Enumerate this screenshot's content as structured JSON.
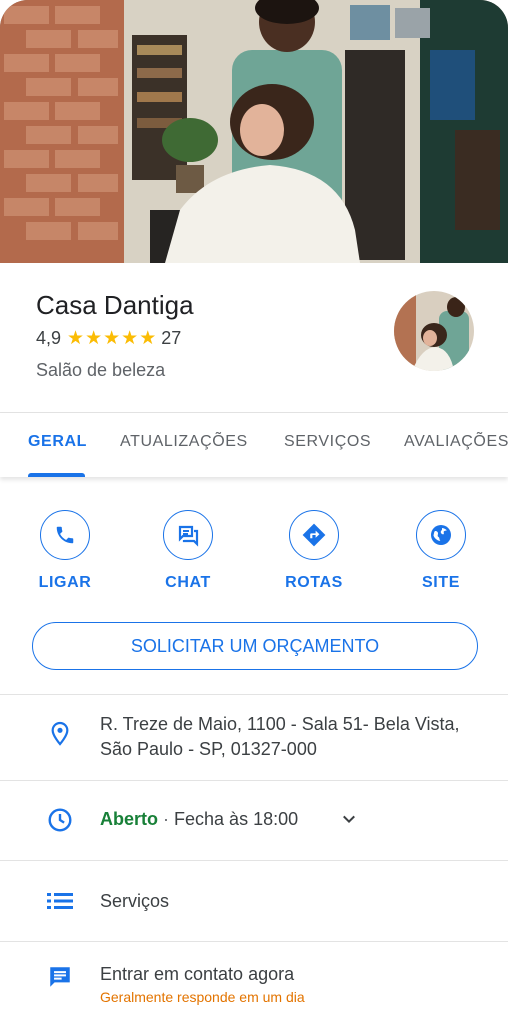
{
  "place": {
    "name": "Casa Dantiga",
    "rating": "4,9",
    "review_count": "27",
    "stars": 4.9,
    "category": "Salão de beleza"
  },
  "tabs": [
    {
      "label": "GERAL",
      "active": true
    },
    {
      "label": "ATUALIZAÇÕES",
      "active": false
    },
    {
      "label": "SERVIÇOS",
      "active": false
    },
    {
      "label": "AVALIAÇÕES",
      "active": false
    }
  ],
  "actions": [
    {
      "label": "LIGAR",
      "icon": "phone-icon"
    },
    {
      "label": "CHAT",
      "icon": "chat-icon"
    },
    {
      "label": "ROTAS",
      "icon": "directions-icon"
    },
    {
      "label": "SITE",
      "icon": "globe-icon"
    }
  ],
  "quote_button": "SOLICITAR UM ORÇAMENTO",
  "address": {
    "line1": "R. Treze de Maio, 1100 - Sala 51- Bela Vista,",
    "line2": "São Paulo - SP, 01327-000",
    "icon": "location-pin-icon"
  },
  "hours": {
    "status": "Aberto",
    "separator": "·",
    "closes": "Fecha às 18:00",
    "icon": "clock-icon"
  },
  "services": {
    "label": "Serviços",
    "icon": "list-icon"
  },
  "contact": {
    "label": "Entrar em contato agora",
    "sub": "Geralmente responde em um dia",
    "icon": "message-icon"
  },
  "colors": {
    "accent": "#1a73e8",
    "star": "#fbbc04",
    "open": "#188038",
    "sub": "#e37400"
  }
}
